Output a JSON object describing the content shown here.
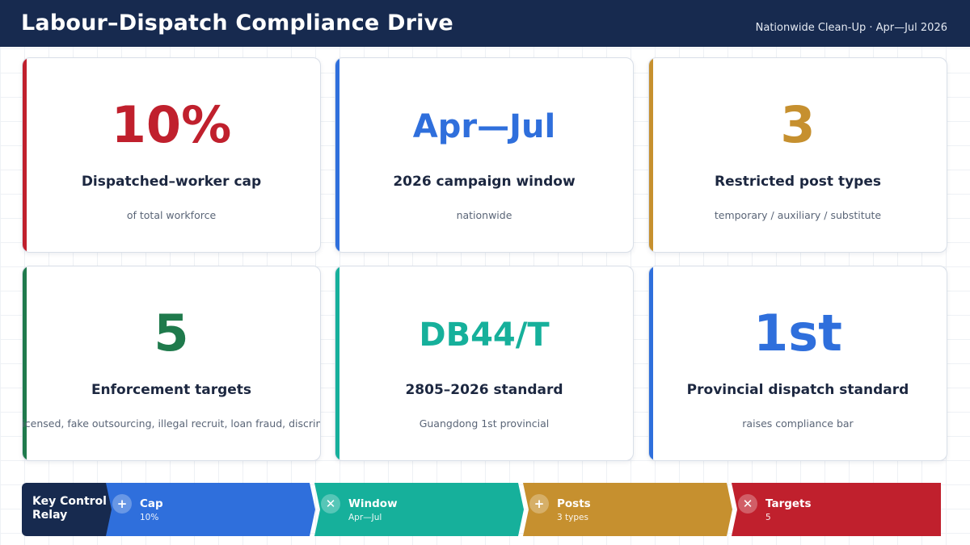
{
  "header": {
    "title": "Labour–Dispatch Compliance Drive",
    "subtitle": "Nationwide Clean-Up · Apr—Jul 2026"
  },
  "cards": [
    {
      "value": "10%",
      "label": "Dispatched–worker cap",
      "sub": "of total workforce",
      "color": "#c0202d"
    },
    {
      "value": "Apr—Jul",
      "label": "2026 campaign window",
      "sub": "nationwide",
      "color": "#2f6fdc"
    },
    {
      "value": "3",
      "label": "Restricted post types",
      "sub": "temporary / auxiliary / substitute",
      "color": "#c6902f"
    },
    {
      "value": "5",
      "label": "Enforcement targets",
      "sub": "unlicensed, fake outsourcing, illegal recruit, loan fraud, discrimination",
      "color": "#1f7a4c"
    },
    {
      "value": "DB44/T",
      "label": "2805–2026 standard",
      "sub": "Guangdong 1st provincial",
      "color": "#16b09b"
    },
    {
      "value": "1st",
      "label": "Provincial dispatch standard",
      "sub": "raises compliance bar",
      "color": "#2f6fdc"
    }
  ],
  "relay": {
    "title_line1": "Key Control",
    "title_line2": "Relay",
    "segments": [
      {
        "icon": "plus-icon",
        "symbol": "+",
        "label": "Cap",
        "value": "10%",
        "color": "#2f6fdc"
      },
      {
        "icon": "close-icon",
        "symbol": "✕",
        "label": "Window",
        "value": "Apr—Jul",
        "color": "#16b09b"
      },
      {
        "icon": "plus-icon",
        "symbol": "+",
        "label": "Posts",
        "value": "3 types",
        "color": "#c6902f"
      },
      {
        "icon": "close-icon",
        "symbol": "✕",
        "label": "Targets",
        "value": "5",
        "color": "#c0202d"
      }
    ]
  }
}
